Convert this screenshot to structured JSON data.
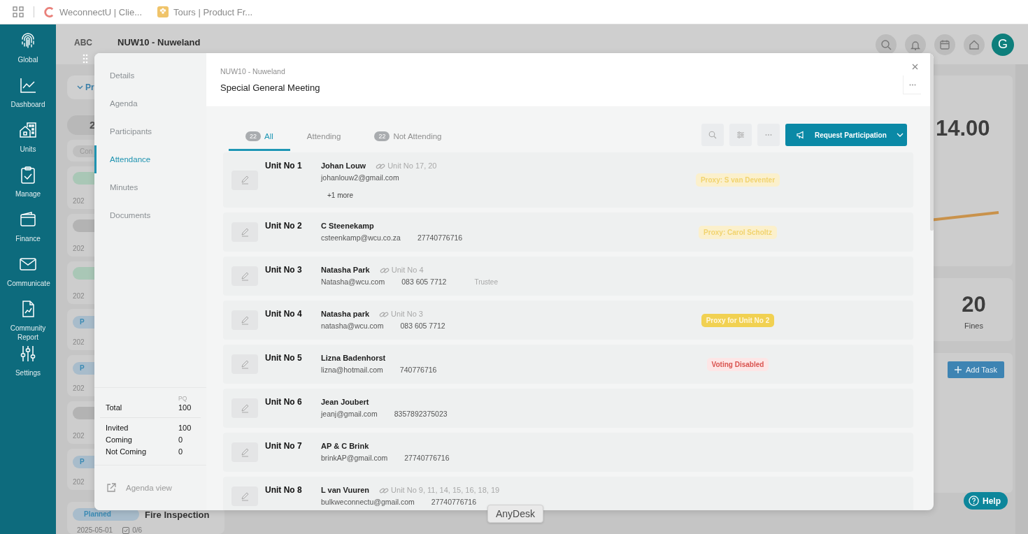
{
  "browser": {
    "tabs": [
      {
        "title": "WeconnectU | Clie..."
      },
      {
        "title": "Tours | Product Fr..."
      }
    ]
  },
  "nav": {
    "items": [
      {
        "label": "Global"
      },
      {
        "label": "Dashboard"
      },
      {
        "label": "Units"
      },
      {
        "label": "Manage"
      },
      {
        "label": "Finance"
      },
      {
        "label": "Communicate"
      },
      {
        "label": "Community Report"
      },
      {
        "label": "Settings"
      }
    ]
  },
  "header": {
    "logo": "ABC",
    "title": "NUW10 - Nuweland",
    "avatar": "G"
  },
  "background": {
    "filter": "Pr",
    "count": "2",
    "chip": "Con",
    "cards": [
      {
        "color": "#a9c7b6",
        "date": "202"
      },
      {
        "color": "#b3b3b3",
        "date": "202"
      },
      {
        "color": "#a9c7b6",
        "date": "202"
      },
      {
        "pill": "P",
        "color": "#a8bccb",
        "date": "202"
      },
      {
        "pill": "P",
        "color": "#a8bccb",
        "date": "202"
      },
      {
        "color": "#b3b3b3",
        "date": "202"
      },
      {
        "pill": "P",
        "color": "#a8bccb",
        "date": "202"
      }
    ],
    "event": {
      "status": "Planned",
      "title": "Fire Inspection",
      "date": "2025-05-01",
      "tasks": "0/6"
    },
    "stat": "14.00",
    "fines": {
      "value": "20",
      "label": "Fines"
    },
    "add_task": "Add Task",
    "help": "Help"
  },
  "modal": {
    "nav": [
      {
        "label": "Details",
        "selected": false
      },
      {
        "label": "Agenda",
        "selected": false
      },
      {
        "label": "Participants",
        "selected": false
      },
      {
        "label": "Attendance",
        "selected": true
      },
      {
        "label": "Minutes",
        "selected": false
      },
      {
        "label": "Documents",
        "selected": false
      }
    ],
    "stats": {
      "column": "PQ",
      "total": {
        "label": "Total",
        "value": "100"
      },
      "rows": [
        {
          "label": "Invited",
          "value": "100"
        },
        {
          "label": "Coming",
          "value": "0"
        },
        {
          "label": "Not Coming",
          "value": "0"
        }
      ]
    },
    "agenda_link": "Agenda view",
    "subtitle": "NUW10 - Nuweland",
    "title": "Special General Meeting",
    "tabs": [
      {
        "label": "All",
        "count": "22",
        "selected": true
      },
      {
        "label": "Attending",
        "selected": false
      },
      {
        "label": "Not Attending",
        "count": "22",
        "selected": false
      }
    ],
    "action": "Request Participation",
    "rows": [
      {
        "unit": "Unit No 1",
        "name": "Johan Louw",
        "linked": "Unit No 17, 20",
        "email": "johanlouw2@gmail.com",
        "more": "+1 more",
        "badge": {
          "kind": "proxy",
          "text": "Proxy: S van Deventer"
        }
      },
      {
        "unit": "Unit No 2",
        "name": "C Steenekamp",
        "email": "csteenkamp@wcu.co.za",
        "phone": "27740776716",
        "badge": {
          "kind": "proxy",
          "text": "Proxy: Carol Scholtz"
        }
      },
      {
        "unit": "Unit No 3",
        "name": "Natasha Park",
        "linked": "Unit No 4",
        "email": "Natasha@wcu.com",
        "phone": "083 605 7712",
        "role": "Trustee"
      },
      {
        "unit": "Unit No 4",
        "name": "Natasha park",
        "linked": "Unit No 3",
        "email": "natasha@wcu.com",
        "phone": "083 605 7712",
        "badge": {
          "kind": "proxy_for",
          "text": "Proxy for Unit No 2"
        }
      },
      {
        "unit": "Unit No 5",
        "name": "Lizna Badenhorst",
        "email": "lizna@hotmail.com",
        "phone": "740776716",
        "badge": {
          "kind": "voting_disabled",
          "text": "Voting Disabled"
        }
      },
      {
        "unit": "Unit No 6",
        "name": "Jean Joubert",
        "email": "jeanj@gmail.com",
        "phone": "8357892375023"
      },
      {
        "unit": "Unit No 7",
        "name": "AP & C Brink",
        "email": "brinkAP@gmail.com",
        "phone": "27740776716"
      },
      {
        "unit": "Unit No 8",
        "name": "L van Vuuren",
        "linked": "Unit No 9, 11, 14, 15, 16, 18, 19",
        "email": "bulkweconnectu@gmail.com",
        "phone": "27740776716"
      }
    ]
  },
  "tooltip": "AnyDesk"
}
